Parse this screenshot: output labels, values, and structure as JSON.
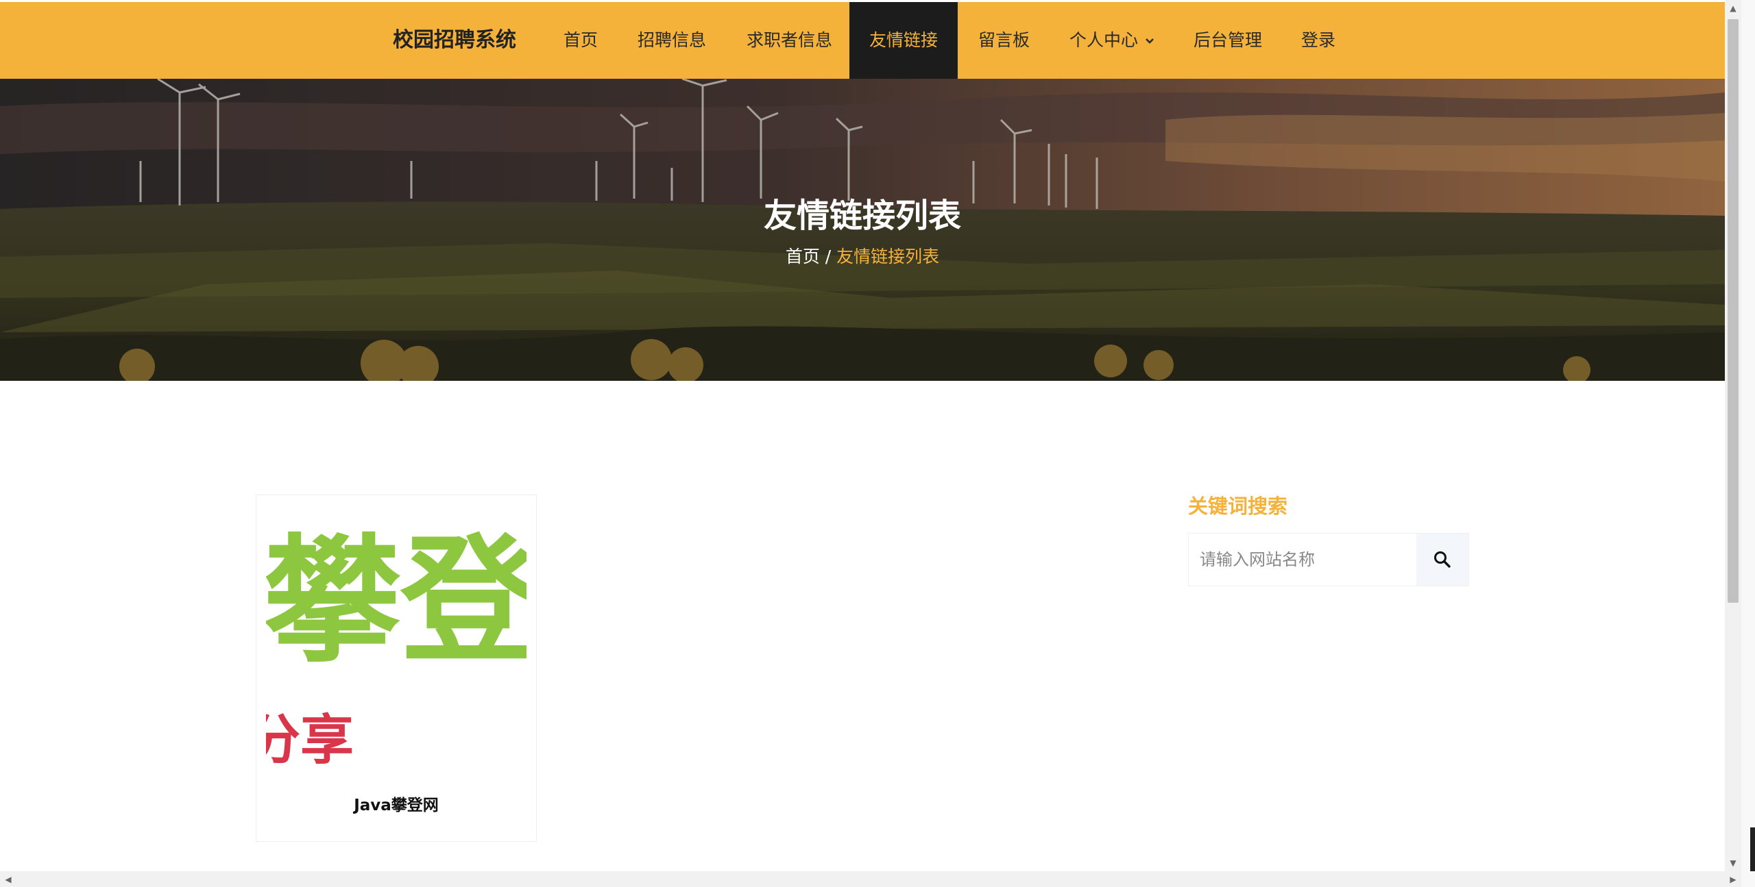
{
  "nav": {
    "brand": "校园招聘系统",
    "items": [
      {
        "label": "首页"
      },
      {
        "label": "招聘信息"
      },
      {
        "label": "求职者信息"
      },
      {
        "label": "友情链接"
      },
      {
        "label": "留言板"
      },
      {
        "label": "个人中心"
      },
      {
        "label": "后台管理"
      },
      {
        "label": "登录"
      }
    ],
    "active_index": 3
  },
  "hero": {
    "title": "友情链接列表",
    "breadcrumb_home": "首页",
    "breadcrumb_sep": "/",
    "breadcrumb_current": "友情链接列表"
  },
  "links": [
    {
      "name": "Java攀登网",
      "logo_text_main": "攀登",
      "logo_text_sub": "分享"
    }
  ],
  "sidebar": {
    "search_title": "关键词搜索",
    "search_placeholder": "请输入网站名称"
  },
  "colors": {
    "accent": "#f5b23b",
    "nav_active_bg": "#1c1c1c",
    "logo_green": "#8dc63f",
    "logo_red": "#d9364a"
  },
  "icons": {
    "search": "search-icon",
    "dropdown": "chevron-down-icon"
  }
}
